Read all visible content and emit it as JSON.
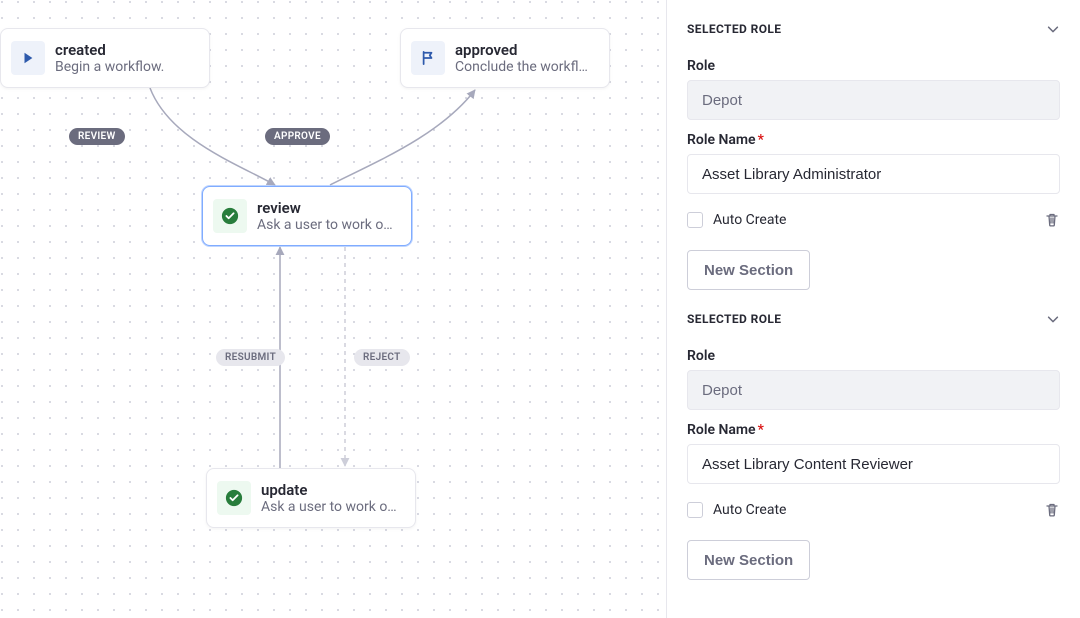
{
  "canvas": {
    "nodes": {
      "created": {
        "title": "created",
        "subtitle": "Begin a workflow."
      },
      "approved": {
        "title": "approved",
        "subtitle": "Conclude the workfl…"
      },
      "review": {
        "title": "review",
        "subtitle": "Ask a user to work o…"
      },
      "update": {
        "title": "update",
        "subtitle": "Ask a user to work o…"
      }
    },
    "edges": {
      "review_label": "REVIEW",
      "approve_label": "APPROVE",
      "resubmit_label": "RESUBMIT",
      "reject_label": "REJECT"
    }
  },
  "sidebar": {
    "roles": [
      {
        "section_title": "SELECTED ROLE",
        "role_label": "Role",
        "role_value": "Depot",
        "name_label": "Role Name",
        "name_value": "Asset Library Administrator",
        "auto_create_label": "Auto Create",
        "new_section_label": "New Section"
      },
      {
        "section_title": "SELECTED ROLE",
        "role_label": "Role",
        "role_value": "Depot",
        "name_label": "Role Name",
        "name_value": "Asset Library Content Reviewer",
        "auto_create_label": "Auto Create",
        "new_section_label": "New Section"
      }
    ]
  }
}
